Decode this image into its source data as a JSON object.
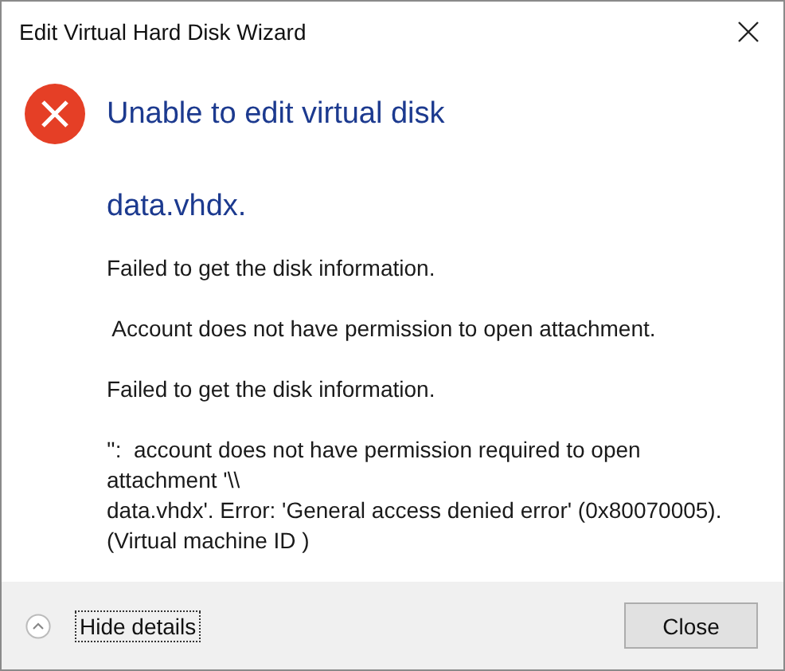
{
  "window": {
    "title": "Edit Virtual Hard Disk Wizard"
  },
  "heading": "Unable to edit virtual disk",
  "subheading": "data.vhdx.",
  "messages": [
    {
      "lines": [
        "Failed to get the disk information."
      ]
    },
    {
      "lines": [
        " Account does not have permission to open attachment."
      ]
    },
    {
      "lines": [
        "Failed to get the disk information."
      ]
    },
    {
      "lines": [
        "'':  account does not have permission required to open",
        "attachment '\\\\",
        "data.vhdx'. Error: 'General access denied error' (0x80070005).",
        "(Virtual machine ID )"
      ]
    }
  ],
  "footer": {
    "details_toggle": {
      "label": "Hide details",
      "expanded": true
    },
    "buttons": [
      "Close"
    ]
  }
}
